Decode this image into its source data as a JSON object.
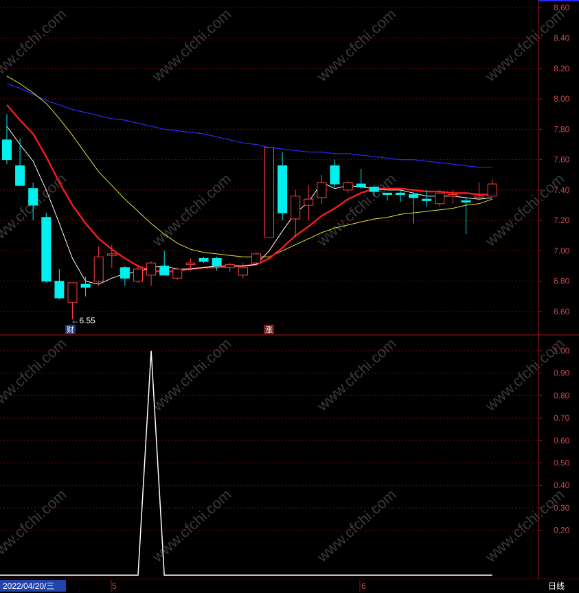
{
  "colors": {
    "background": "#000000",
    "grid": "#7a0a0a",
    "axis": "#a31515",
    "axis_text": "#c84b4b",
    "up_candle": "#ff4040",
    "down_candle": "#00f0f0",
    "ma5": "#ffffff",
    "ma10": "#ff1a1a",
    "ma20": "#e6e632",
    "ma60": "#2a2aff",
    "indicator": "#ffffff",
    "date_badge_bg": "#2244aa",
    "cai_badge_bg": "#1a3a7a",
    "zhang_badge_bg": "#7a1a1a"
  },
  "watermark": "www.cfchi.com",
  "annotations": {
    "low_label": "←6.55",
    "cai_badge": "财",
    "zhang_badge": "涨"
  },
  "bottom_bar": {
    "date": "2022/04/20/三",
    "month_5": "5",
    "month_6": "6",
    "period": "日线"
  },
  "chart_data": [
    {
      "type": "candlestick",
      "y_ticks": [
        "8.60",
        "8.40",
        "8.20",
        "8.00",
        "7.80",
        "7.60",
        "7.40",
        "7.20",
        "7.00",
        "6.80",
        "6.60"
      ],
      "ylim": [
        6.45,
        8.62
      ],
      "candles": [
        {
          "o": 7.73,
          "h": 7.9,
          "l": 7.57,
          "c": 7.6
        },
        {
          "o": 7.56,
          "h": 7.74,
          "l": 7.43,
          "c": 7.43
        },
        {
          "o": 7.41,
          "h": 7.45,
          "l": 7.2,
          "c": 7.3
        },
        {
          "o": 7.22,
          "h": 7.25,
          "l": 6.79,
          "c": 6.8
        },
        {
          "o": 6.8,
          "h": 6.88,
          "l": 6.68,
          "c": 6.69
        },
        {
          "o": 6.66,
          "h": 6.79,
          "l": 6.55,
          "c": 6.79
        },
        {
          "o": 6.78,
          "h": 6.83,
          "l": 6.7,
          "c": 6.76
        },
        {
          "o": 6.8,
          "h": 7.03,
          "l": 6.77,
          "c": 6.96
        },
        {
          "o": 6.97,
          "h": 7.04,
          "l": 6.89,
          "c": 6.98
        },
        {
          "o": 6.89,
          "h": 6.9,
          "l": 6.77,
          "c": 6.82
        },
        {
          "o": 6.8,
          "h": 6.9,
          "l": 6.79,
          "c": 6.88
        },
        {
          "o": 6.84,
          "h": 6.93,
          "l": 6.77,
          "c": 6.92
        },
        {
          "o": 6.9,
          "h": 7.0,
          "l": 6.86,
          "c": 6.84
        },
        {
          "o": 6.82,
          "h": 6.89,
          "l": 6.81,
          "c": 6.88
        },
        {
          "o": 6.91,
          "h": 6.95,
          "l": 6.87,
          "c": 6.92
        },
        {
          "o": 6.95,
          "h": 6.96,
          "l": 6.92,
          "c": 6.93
        },
        {
          "o": 6.95,
          "h": 6.96,
          "l": 6.87,
          "c": 6.9
        },
        {
          "o": 6.89,
          "h": 6.92,
          "l": 6.86,
          "c": 6.91
        },
        {
          "o": 6.84,
          "h": 6.92,
          "l": 6.82,
          "c": 6.89
        },
        {
          "o": 6.92,
          "h": 6.99,
          "l": 6.92,
          "c": 6.98
        },
        {
          "o": 7.09,
          "h": 7.68,
          "l": 7.09,
          "c": 7.68
        },
        {
          "o": 7.56,
          "h": 7.65,
          "l": 7.2,
          "c": 7.25
        },
        {
          "o": 7.21,
          "h": 7.4,
          "l": 7.09,
          "c": 7.36
        },
        {
          "o": 7.3,
          "h": 7.43,
          "l": 7.2,
          "c": 7.34
        },
        {
          "o": 7.35,
          "h": 7.5,
          "l": 7.31,
          "c": 7.45
        },
        {
          "o": 7.56,
          "h": 7.6,
          "l": 7.42,
          "c": 7.44
        },
        {
          "o": 7.4,
          "h": 7.46,
          "l": 7.38,
          "c": 7.45
        },
        {
          "o": 7.44,
          "h": 7.54,
          "l": 7.41,
          "c": 7.42
        },
        {
          "o": 7.42,
          "h": 7.43,
          "l": 7.36,
          "c": 7.39
        },
        {
          "o": 7.38,
          "h": 7.38,
          "l": 7.33,
          "c": 7.37
        },
        {
          "o": 7.38,
          "h": 7.4,
          "l": 7.32,
          "c": 7.37
        },
        {
          "o": 7.37,
          "h": 7.39,
          "l": 7.18,
          "c": 7.35
        },
        {
          "o": 7.34,
          "h": 7.4,
          "l": 7.29,
          "c": 7.33
        },
        {
          "o": 7.31,
          "h": 7.4,
          "l": 7.29,
          "c": 7.38
        },
        {
          "o": 7.36,
          "h": 7.4,
          "l": 7.31,
          "c": 7.37
        },
        {
          "o": 7.33,
          "h": 7.35,
          "l": 7.11,
          "c": 7.32
        },
        {
          "o": 7.35,
          "h": 7.45,
          "l": 7.33,
          "c": 7.36
        },
        {
          "o": 7.36,
          "h": 7.47,
          "l": 7.36,
          "c": 7.44
        }
      ],
      "ma5": [
        7.82,
        7.7,
        7.59,
        7.4,
        7.18,
        6.95,
        6.8,
        6.78,
        6.82,
        6.85,
        6.86,
        6.89,
        6.9,
        6.88,
        6.88,
        6.89,
        6.9,
        6.9,
        6.9,
        6.91,
        7.0,
        7.13,
        7.25,
        7.32,
        7.45,
        7.41,
        7.43,
        7.42,
        7.41,
        7.4,
        7.4,
        7.38,
        7.36,
        7.36,
        7.36,
        7.35,
        7.34,
        7.35
      ],
      "ma10": [
        7.96,
        7.86,
        7.77,
        7.62,
        7.45,
        7.3,
        7.18,
        7.08,
        7.01,
        6.95,
        6.9,
        6.87,
        6.86,
        6.87,
        6.88,
        6.89,
        6.89,
        6.9,
        6.9,
        6.91,
        6.95,
        7.02,
        7.1,
        7.16,
        7.23,
        7.28,
        7.34,
        7.38,
        7.41,
        7.41,
        7.41,
        7.4,
        7.39,
        7.39,
        7.38,
        7.38,
        7.37,
        7.37
      ],
      "ma20": [
        8.15,
        8.1,
        8.04,
        7.97,
        7.87,
        7.76,
        7.64,
        7.52,
        7.43,
        7.34,
        7.26,
        7.18,
        7.11,
        7.05,
        7.01,
        6.99,
        6.98,
        6.97,
        6.96,
        6.96,
        6.96,
        7.0,
        7.04,
        7.08,
        7.12,
        7.15,
        7.17,
        7.19,
        7.21,
        7.22,
        7.24,
        7.25,
        7.26,
        7.27,
        7.28,
        7.3,
        7.31,
        7.34
      ],
      "ma60": [
        8.1,
        8.07,
        8.03,
        7.99,
        7.96,
        7.93,
        7.91,
        7.89,
        7.87,
        7.86,
        7.84,
        7.82,
        7.8,
        7.79,
        7.78,
        7.77,
        7.75,
        7.73,
        7.71,
        7.7,
        7.68,
        7.67,
        7.66,
        7.65,
        7.65,
        7.64,
        7.64,
        7.63,
        7.62,
        7.61,
        7.6,
        7.6,
        7.59,
        7.58,
        7.57,
        7.56,
        7.55,
        7.55
      ]
    },
    {
      "type": "line",
      "y_ticks": [
        "1.00",
        "0.90",
        "0.80",
        "0.70",
        "0.60",
        "0.50",
        "0.40",
        "0.30",
        "0.20"
      ],
      "ylim": [
        0,
        1
      ],
      "values": [
        0,
        0,
        0,
        0,
        0,
        0,
        0,
        0,
        0,
        0,
        0,
        1,
        0,
        0,
        0,
        0,
        0,
        0,
        0,
        0,
        0,
        0,
        0,
        0,
        0,
        0,
        0,
        0,
        0,
        0,
        0,
        0,
        0,
        0,
        0,
        0,
        0,
        0
      ]
    }
  ]
}
